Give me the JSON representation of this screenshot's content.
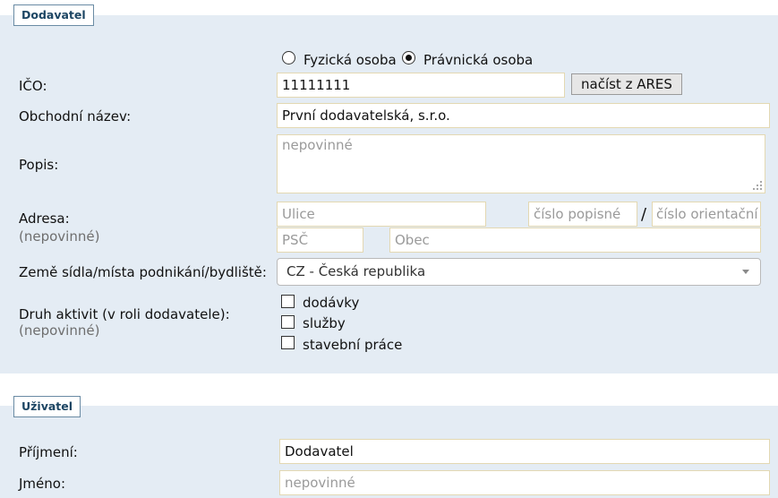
{
  "supplier": {
    "legend": "Dodavatel",
    "entity_type": {
      "options": [
        "Fyzická osoba",
        "Právnická osoba"
      ],
      "selected": "Právnická osoba"
    },
    "ico": {
      "label": "IČO:",
      "value": "11111111",
      "ares_button": "načíst z ARES"
    },
    "company_name": {
      "label": "Obchodní název:",
      "value": "První dodavatelská, s.r.o."
    },
    "description": {
      "label": "Popis:",
      "placeholder": "nepovinné",
      "value": ""
    },
    "address": {
      "label": "Adresa:",
      "sublabel": "(nepovinné)",
      "street_placeholder": "Ulice",
      "house_number_placeholder": "číslo popisné",
      "separator": "/",
      "orientation_number_placeholder": "číslo orientační",
      "zip_placeholder": "PSČ",
      "city_placeholder": "Obec"
    },
    "country": {
      "label": "Země sídla/místa podnikání/bydliště:",
      "value": "CZ - Česká republika"
    },
    "activities": {
      "label": "Druh aktivit (v roli dodavatele):",
      "sublabel": "(nepovinné)",
      "options": [
        {
          "label": "dodávky",
          "checked": false
        },
        {
          "label": "služby",
          "checked": false
        },
        {
          "label": "stavební práce",
          "checked": false
        }
      ]
    }
  },
  "user": {
    "legend": "Uživatel",
    "surname": {
      "label": "Příjmení:",
      "value": "Dodavatel"
    },
    "first_name": {
      "label": "Jméno:",
      "placeholder": "nepovinné",
      "value": ""
    }
  }
}
